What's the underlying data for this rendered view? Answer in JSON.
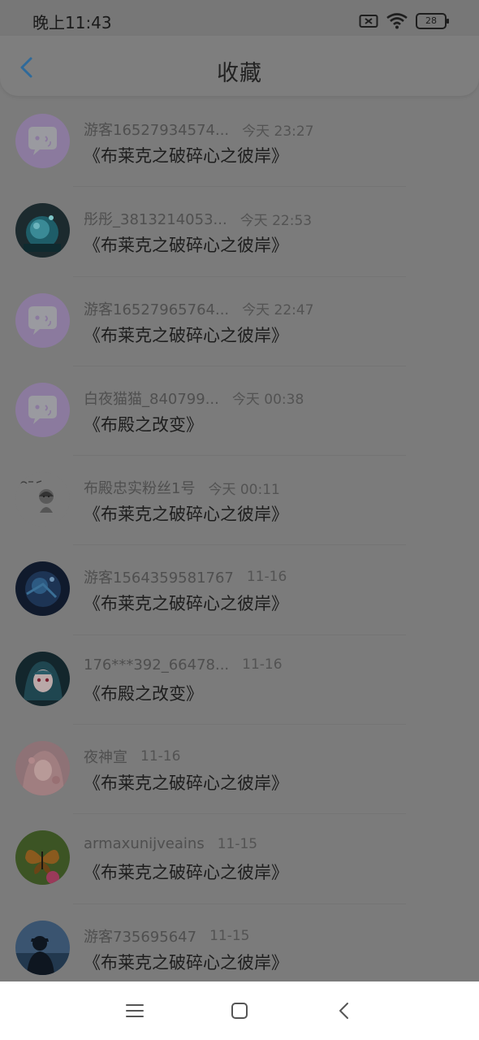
{
  "status_bar": {
    "time": "晚上11:43",
    "battery": "28"
  },
  "header": {
    "title": "收藏"
  },
  "favorites": [
    {
      "name": "游客16527934574...",
      "time": "今天 23:27",
      "book": "《布莱克之破碎心之彼岸》",
      "avatar": "chat-bubble-avatar"
    },
    {
      "name": "彤彤_3813214053...",
      "time": "今天 22:53",
      "book": "《布莱克之破碎心之彼岸》",
      "avatar": "blue-glass-avatar"
    },
    {
      "name": "游客16527965764...",
      "time": "今天 22:47",
      "book": "《布莱克之破碎心之彼岸》",
      "avatar": "chat-bubble-avatar"
    },
    {
      "name": "白夜猫猫_840799...",
      "time": "今天 00:38",
      "book": "《布殿之改变》",
      "avatar": "chat-bubble-avatar"
    },
    {
      "name": "布殿忠实粉丝1号",
      "time": "今天 00:11",
      "book": "《布莱克之破碎心之彼岸》",
      "avatar": "sketch-character-avatar"
    },
    {
      "name": "游客1564359581767",
      "time": "11-16",
      "book": "《布莱克之破碎心之彼岸》",
      "avatar": "underwater-scene-avatar"
    },
    {
      "name": "176***392_66478...",
      "time": "11-16",
      "book": "《布殿之改变》",
      "avatar": "anime-girl-avatar"
    },
    {
      "name": "夜神宣",
      "time": "11-16",
      "book": "《布莱克之破碎心之彼岸》",
      "avatar": "pink-anime-avatar"
    },
    {
      "name": "armaxunijveains",
      "time": "11-15",
      "book": "《布莱克之破碎心之彼岸》",
      "avatar": "butterfly-avatar"
    },
    {
      "name": "游客735695647",
      "time": "11-15",
      "book": "《布莱克之破碎心之彼岸》",
      "avatar": "silhouette-avatar"
    }
  ],
  "nav_bar": {
    "items": [
      "menu-icon",
      "home-icon",
      "back-icon"
    ]
  }
}
